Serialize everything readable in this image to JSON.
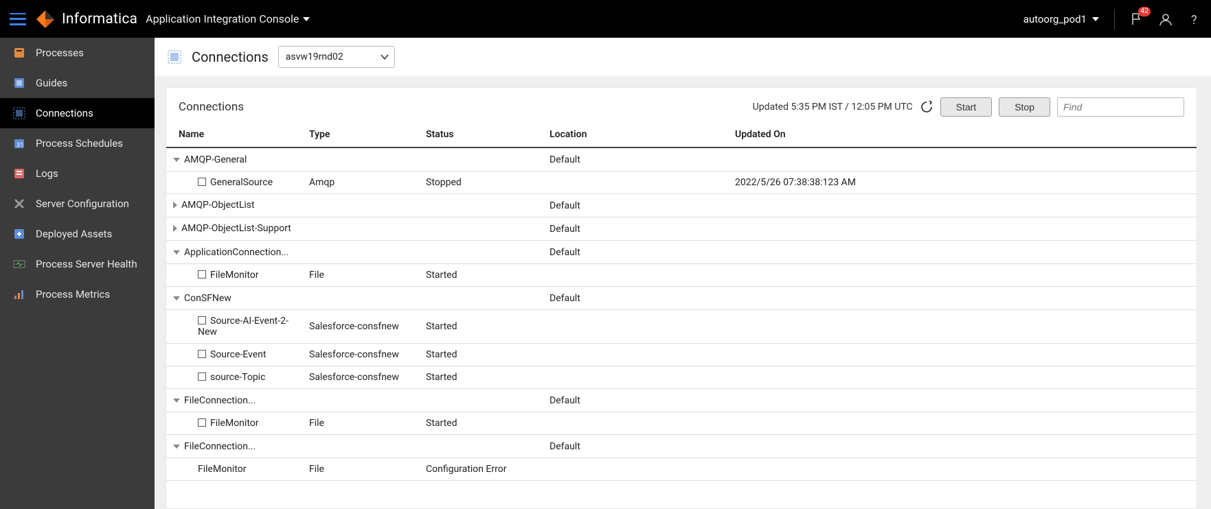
{
  "header": {
    "brand": "Informatica",
    "subtitle": "Application Integration Console",
    "org": "autoorg_pod1",
    "notification_count": "42"
  },
  "sidebar": {
    "items": [
      {
        "label": "Processes",
        "icon": "proc"
      },
      {
        "label": "Guides",
        "icon": "guide"
      },
      {
        "label": "Connections",
        "icon": "conn",
        "active": true
      },
      {
        "label": "Process Schedules",
        "icon": "sched"
      },
      {
        "label": "Logs",
        "icon": "logs"
      },
      {
        "label": "Server Configuration",
        "icon": "servcfg"
      },
      {
        "label": "Deployed Assets",
        "icon": "depl"
      },
      {
        "label": "Process Server Health",
        "icon": "health"
      },
      {
        "label": "Process Metrics",
        "icon": "metrics"
      }
    ]
  },
  "page": {
    "title": "Connections",
    "server": "asvw19rnd02"
  },
  "panel": {
    "title": "Connections",
    "updated": "Updated 5:35 PM IST / 12:05 PM UTC",
    "start_label": "Start",
    "stop_label": "Stop",
    "find_placeholder": "Find"
  },
  "columns": {
    "name": "Name",
    "type": "Type",
    "status": "Status",
    "location": "Location",
    "updated": "Updated On"
  },
  "rows": [
    {
      "kind": "group",
      "expanded": true,
      "name": "AMQP-General",
      "location": "Default"
    },
    {
      "kind": "item",
      "checkbox": true,
      "name": "GeneralSource",
      "type": "Amqp",
      "status": "Stopped",
      "updated": "2022/5/26 07:38:38:123 AM"
    },
    {
      "kind": "group",
      "expanded": false,
      "name": "AMQP-ObjectList",
      "location": "Default"
    },
    {
      "kind": "group",
      "expanded": false,
      "name": "AMQP-ObjectList-Support",
      "location": "Default"
    },
    {
      "kind": "group",
      "expanded": true,
      "name": "ApplicationConnection...",
      "location": "Default"
    },
    {
      "kind": "item",
      "checkbox": true,
      "name": "FileMonitor",
      "type": "File",
      "status": "Started"
    },
    {
      "kind": "group",
      "expanded": true,
      "name": "ConSFNew",
      "location": "Default"
    },
    {
      "kind": "item",
      "checkbox": true,
      "name": "Source-AI-Event-2-New",
      "type": "Salesforce-consfnew",
      "status": "Started"
    },
    {
      "kind": "item",
      "checkbox": true,
      "name": "Source-Event",
      "type": "Salesforce-consfnew",
      "status": "Started"
    },
    {
      "kind": "item",
      "checkbox": true,
      "name": "source-Topic",
      "type": "Salesforce-consfnew",
      "status": "Started"
    },
    {
      "kind": "group",
      "expanded": true,
      "name": "FileConnection...",
      "location": "Default"
    },
    {
      "kind": "item",
      "checkbox": true,
      "name": "FileMonitor",
      "type": "File",
      "status": "Started"
    },
    {
      "kind": "group",
      "expanded": true,
      "name": "FileConnection...",
      "location": "Default"
    },
    {
      "kind": "item",
      "checkbox": false,
      "name": "FileMonitor",
      "type": "File",
      "status": "Configuration Error"
    }
  ]
}
